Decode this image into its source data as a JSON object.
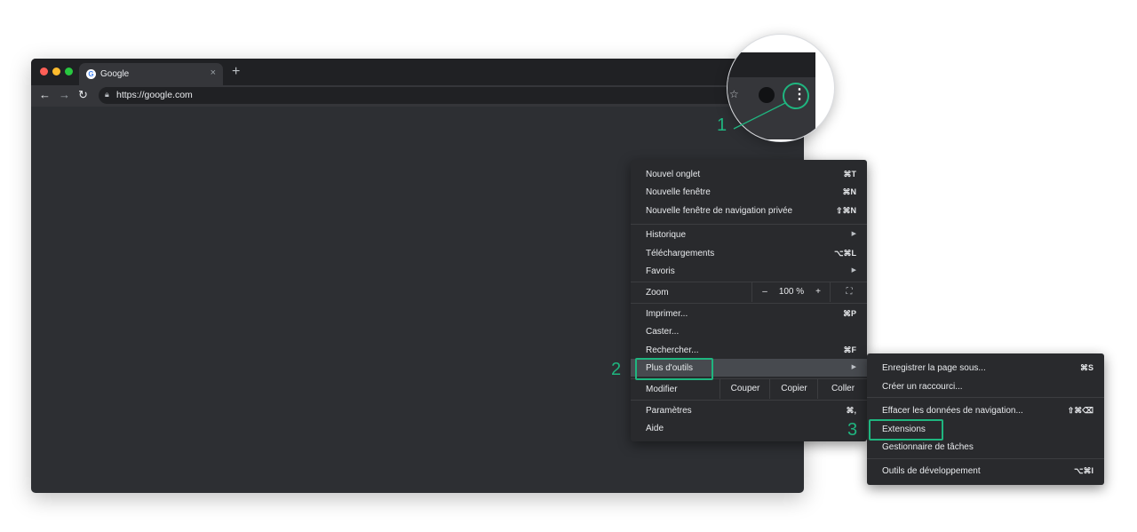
{
  "browser": {
    "tab_title": "Google",
    "tab_favicon_letter": "G",
    "tab_close": "×",
    "new_tab": "+",
    "url": "https://google.com",
    "icons": [
      "back-icon",
      "forward-icon",
      "reload-icon",
      "lock-icon",
      "star-icon",
      "profile-icon",
      "kebab-menu-icon"
    ]
  },
  "colors": {
    "accent_green": "#1fb57f",
    "window_dark": "#2d2f33",
    "menu_bg": "#292a2d",
    "highlight": "#474a4f",
    "traffic_red": "#ff5f57",
    "traffic_yellow": "#febc2e",
    "traffic_green": "#28c840"
  },
  "steps": {
    "one": "1",
    "two": "2",
    "three": "3"
  },
  "menu": {
    "new_tab": {
      "label": "Nouvel onglet",
      "shortcut": "⌘T"
    },
    "new_window": {
      "label": "Nouvelle fenêtre",
      "shortcut": "⌘N"
    },
    "incognito": {
      "label": "Nouvelle fenêtre de navigation privée",
      "shortcut": "⇧⌘N"
    },
    "history": {
      "label": "Historique"
    },
    "downloads": {
      "label": "Téléchargements",
      "shortcut": "⌥⌘L"
    },
    "bookmarks": {
      "label": "Favoris"
    },
    "zoom": {
      "label": "Zoom",
      "minus": "–",
      "value": "100 %",
      "plus": "+"
    },
    "print": {
      "label": "Imprimer...",
      "shortcut": "⌘P"
    },
    "cast": {
      "label": "Caster..."
    },
    "find": {
      "label": "Rechercher...",
      "shortcut": "⌘F"
    },
    "more_tools": {
      "label": "Plus d'outils"
    },
    "edit": {
      "label": "Modifier",
      "cut": "Couper",
      "copy": "Copier",
      "paste": "Coller"
    },
    "settings": {
      "label": "Paramètres",
      "shortcut": "⌘,"
    },
    "help": {
      "label": "Aide"
    }
  },
  "submenu": {
    "save_page": {
      "label": "Enregistrer la page sous...",
      "shortcut": "⌘S"
    },
    "create_shortcut": {
      "label": "Créer un raccourci..."
    },
    "clear_data": {
      "label": "Effacer les données de navigation...",
      "shortcut": "⇧⌘⌫"
    },
    "extensions": {
      "label": "Extensions"
    },
    "task_manager": {
      "label": "Gestionnaire de tâches"
    },
    "dev_tools": {
      "label": "Outils de développement",
      "shortcut": "⌥⌘I"
    }
  }
}
